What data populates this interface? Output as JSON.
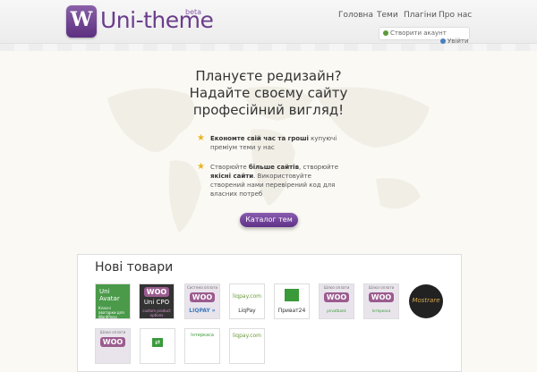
{
  "header": {
    "logo_letter": "W",
    "site_name": "Uni-theme",
    "beta": "beta",
    "nav": [
      {
        "label": "Головна"
      },
      {
        "label": "Теми"
      },
      {
        "label": "Плагіни"
      },
      {
        "label": "Про нас"
      }
    ],
    "create_account": "Створити акаунт",
    "login": "Увійти"
  },
  "hero": {
    "line1": "Плануєте редизайн?",
    "line2": "Надайте своєму сайту",
    "line3": "професійний вигляд!"
  },
  "features": [
    {
      "bold": "Економте свій час та гроші",
      "text": " купуючі преміум теми у нас"
    },
    {
      "pre": "Створюйте ",
      "bold": "більше сайтів",
      "mid": ", створюйте ",
      "bold2": "якісні сайти",
      "text": ". Використовуйте створений нами перевірений код для власних потреб"
    }
  ],
  "catalog_button": "Каталог тем",
  "products": {
    "title": "Нові товари",
    "items": [
      {
        "top": "Uni",
        "bottom": "Avatar",
        "caption": "Класні аватарки для WordPress"
      },
      {
        "badge": "WOO",
        "bottom": "Uni CPO",
        "caption": "custom product options"
      },
      {
        "badge": "WOO",
        "bottom": "LIQPAY »",
        "caption": "Система оплати"
      },
      {
        "badge": "liqpay.com",
        "bottom": "LiqPay"
      },
      {
        "badge": "Privat",
        "bottom": "Приват24"
      },
      {
        "badge": "WOO",
        "bottom": "privatbank",
        "caption": "Шлюз оплати"
      },
      {
        "badge": "WOO",
        "bottom": "Інтеркаса",
        "caption": "Шлюз оплати"
      },
      {
        "bottom": "Mostrare"
      },
      {
        "badge": "WOO",
        "caption": "Шлюз оплати"
      },
      {
        "badge": "⇄"
      },
      {
        "badge": "Інтеркаса"
      },
      {
        "badge": "liqpay.com"
      }
    ]
  },
  "colors": {
    "brand": "#6a3d8c",
    "accent": "#7a4ea0",
    "star": "#e8b520",
    "woo": "#9b5c8f",
    "green": "#3a9a3a"
  }
}
